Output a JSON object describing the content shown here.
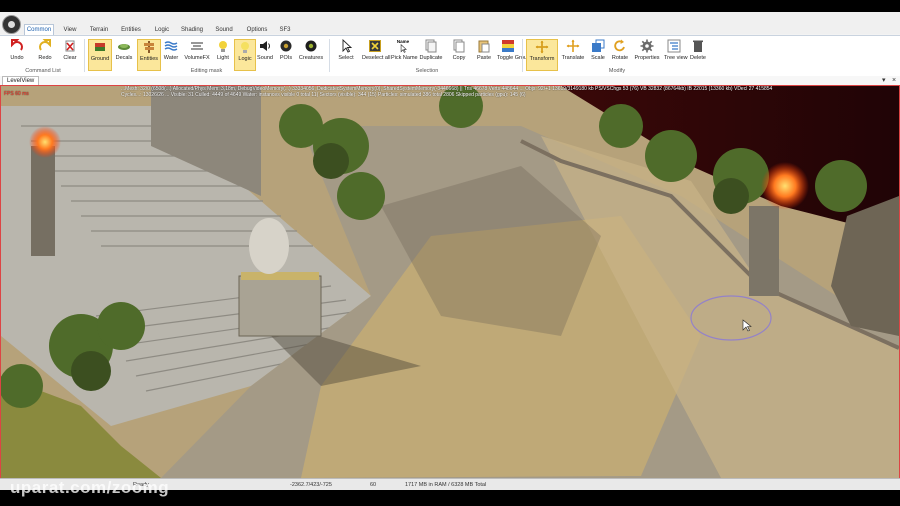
{
  "ribbon": {
    "tabs": [
      {
        "label": "Common",
        "active": true
      },
      {
        "label": "View"
      },
      {
        "label": "Terrain"
      },
      {
        "label": "Entities"
      },
      {
        "label": "Logic"
      },
      {
        "label": "Shading"
      },
      {
        "label": "Sound"
      },
      {
        "label": "Options"
      },
      {
        "label": "SF3"
      }
    ],
    "buttons": {
      "undo": "Undo",
      "redo": "Redo",
      "clear": "Clear",
      "ground": "Ground",
      "decals": "Decals",
      "entities": "Entities",
      "water": "Water",
      "volumefx": "VolumeFX",
      "light": "Light",
      "logic": "Logic",
      "sound": "Sound",
      "pois": "POIs",
      "creatures": "Creatures",
      "select": "Select",
      "deselect": "Deselect all",
      "pick_name": "Pick Name",
      "duplicate": "Duplicate",
      "copy": "Copy",
      "paste": "Paste",
      "toggle_group": "Toggle Group",
      "transform": "Transform",
      "translate": "Translate",
      "scale": "Scale",
      "rotate": "Rotate",
      "properties": "Properties",
      "tree_view": "Tree view",
      "delete": "Delete"
    },
    "group_labels": {
      "command_list": "Command List",
      "editing_mask": "Editing mask",
      "selection": "Selection",
      "modify": "Modify"
    },
    "name_header": "Name"
  },
  "view_tab": {
    "label": "LevelView"
  },
  "viewport": {
    "debug_line1": "...Mesh: 32/0 (6508(...) Allocated/Phys Mem: 3,18m, DebugVideoMemory(...) 33334056, DedicatedSystemMemory(0), SharedSystemMemory(-3446668) || Tris 46678 Verts 448644 ... Objs: 92/+1 13619/3149180 kb PS/VSChgs 53 (76) VB 32832 (86764kb) IB 22015 (13360 kb) VDecl 27 415854",
    "debug_line2": "Cycles...: 13026/26 ... Visible: 31 Culled: 4449 of 4649 Water: instances visible 0 total 11) Sectors (visible): 344 (15) Particles: simulated 386 total 2806 Skipped particles (gpu): 145 (6)",
    "debug_red": "FPS 60 ms"
  },
  "status_bar": {
    "ready": "Ready",
    "coords": "-2362.7/423/-725",
    "fps": "60",
    "memory": "1717 MB in RAM / 6328 MB Total"
  },
  "watermark": "uparat.com/zoomg",
  "colors": {
    "ribbon_highlight": "#fbe79b",
    "active_tab_text": "#1b5fae",
    "viewport_border": "#dd4444"
  }
}
